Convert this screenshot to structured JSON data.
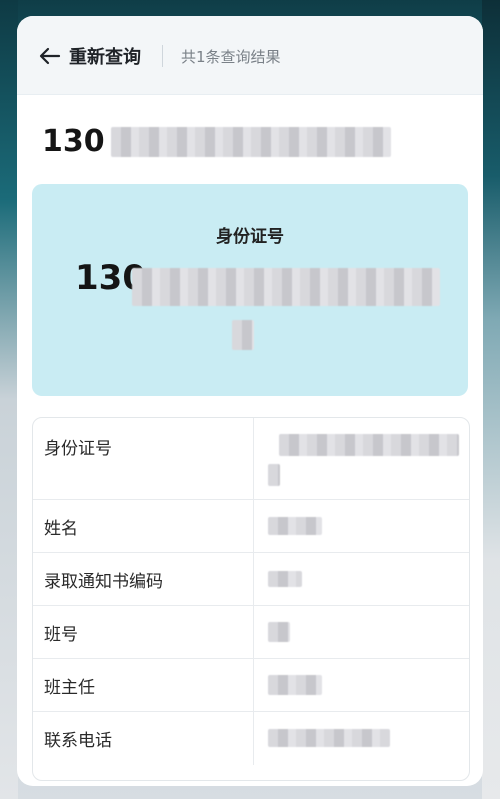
{
  "header": {
    "back_label": "重新查询",
    "result_count": "共1条查询结果"
  },
  "record": {
    "id_prefix": "130"
  },
  "card": {
    "label": "身份证号",
    "id_prefix": "130"
  },
  "details": {
    "rows": [
      {
        "label": "身份证号"
      },
      {
        "label": "姓名"
      },
      {
        "label": "录取通知书编码"
      },
      {
        "label": "班号"
      },
      {
        "label": "班主任"
      },
      {
        "label": "联系电话"
      }
    ]
  },
  "colors": {
    "card_bg": "#c9ecf3",
    "text_primary": "#151515",
    "text_secondary": "#7a8188"
  },
  "icons": {
    "back": "arrow-left-icon"
  }
}
